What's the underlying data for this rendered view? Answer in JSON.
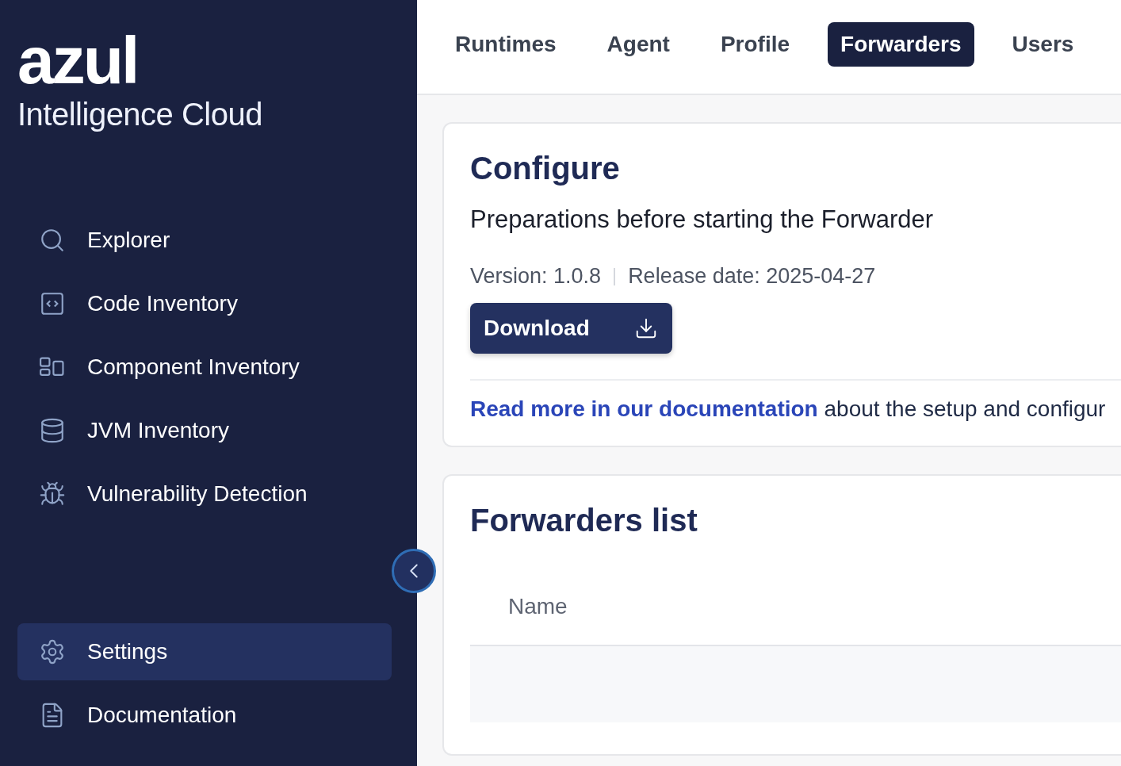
{
  "brand": {
    "logo": "azul",
    "product": "Intelligence Cloud"
  },
  "nav": [
    {
      "label": "Explorer",
      "kind": "search",
      "selected": false
    },
    {
      "label": "Code Inventory",
      "kind": "code",
      "selected": false
    },
    {
      "label": "Component Inventory",
      "kind": "components",
      "selected": false
    },
    {
      "label": "JVM Inventory",
      "kind": "database",
      "selected": false
    },
    {
      "label": "Vulnerability Detection",
      "kind": "bug",
      "selected": false
    }
  ],
  "bottom_nav": [
    {
      "label": "Settings",
      "kind": "gear",
      "selected": true
    },
    {
      "label": "Documentation",
      "kind": "file",
      "selected": false
    }
  ],
  "tabs": [
    {
      "label": "Runtimes",
      "selected": false
    },
    {
      "label": "Agent",
      "selected": false
    },
    {
      "label": "Profile",
      "selected": false
    },
    {
      "label": "Forwarders",
      "selected": true
    },
    {
      "label": "Users",
      "selected": false
    }
  ],
  "configure": {
    "title": "Configure",
    "subtitle": "Preparations before starting the Forwarder",
    "version": "Version: 1.0.8",
    "release_date": "Release date: 2025-04-27",
    "download_button": "Download",
    "doc_link": "Read more in our documentation",
    "doc_text": "about the setup and configur"
  },
  "forwarders_list": {
    "title": "Forwarders list",
    "columns": [
      "Name"
    ]
  }
}
